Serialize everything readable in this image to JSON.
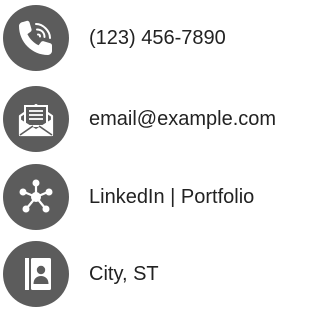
{
  "contact": {
    "phone": {
      "icon": "phone-icon",
      "text": "(123) 456-7890"
    },
    "email": {
      "icon": "email-icon",
      "text": "email@example.com"
    },
    "links": {
      "icon": "network-icon",
      "text": "LinkedIn | Portfolio"
    },
    "location": {
      "icon": "address-book-icon",
      "text": "City, ST"
    }
  },
  "colors": {
    "icon_circle": "#5c5c5c",
    "icon_glyph": "#ffffff",
    "text": "#222222"
  }
}
